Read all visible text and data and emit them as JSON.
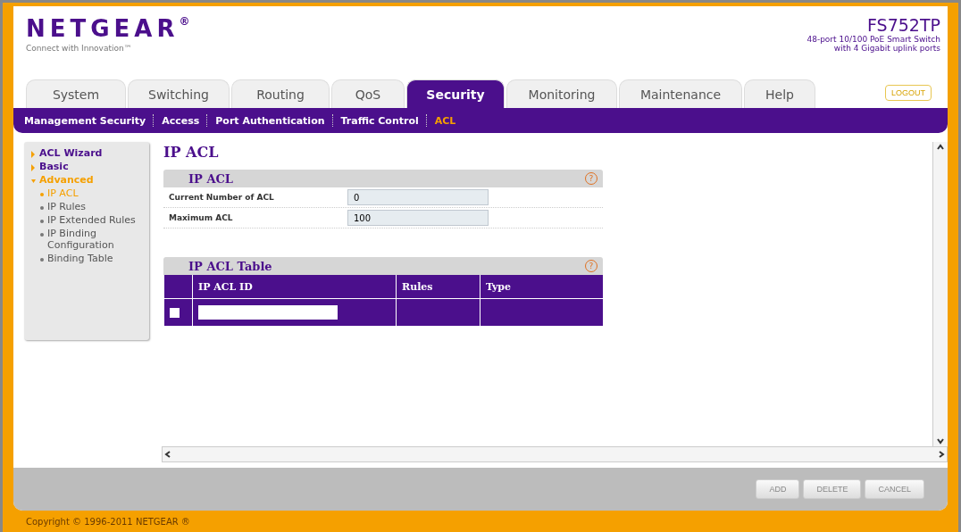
{
  "brand": {
    "logo": "NETGEAR",
    "registered": "®",
    "tagline": "Connect with Innovation™"
  },
  "product": {
    "model": "FS752TP",
    "description_1": "48-port 10/100 PoE Smart Switch",
    "description_2": "with 4 Gigabit uplink ports"
  },
  "logout": "LOGOUT",
  "tabs": [
    {
      "label": "System",
      "selected": false
    },
    {
      "label": "Switching",
      "selected": false
    },
    {
      "label": "Routing",
      "selected": false
    },
    {
      "label": "QoS",
      "selected": false
    },
    {
      "label": "Security",
      "selected": true
    },
    {
      "label": "Monitoring",
      "selected": false
    },
    {
      "label": "Maintenance",
      "selected": false
    },
    {
      "label": "Help",
      "selected": false
    }
  ],
  "subtabs": [
    {
      "label": "Management Security",
      "selected": false
    },
    {
      "label": "Access",
      "selected": false
    },
    {
      "label": "Port Authentication",
      "selected": false
    },
    {
      "label": "Traffic Control",
      "selected": false
    },
    {
      "label": "ACL",
      "selected": true
    }
  ],
  "sidebar": {
    "items": [
      {
        "label": "ACL Wizard",
        "selected": false,
        "expanded": false
      },
      {
        "label": "Basic",
        "selected": false,
        "expanded": false
      },
      {
        "label": "Advanced",
        "selected": true,
        "expanded": true,
        "children": [
          {
            "label": "IP ACL",
            "selected": true
          },
          {
            "label": "IP Rules",
            "selected": false
          },
          {
            "label": "IP Extended Rules",
            "selected": false
          },
          {
            "label": "IP Binding Configuration",
            "selected": false
          },
          {
            "label": "Binding Table",
            "selected": false
          }
        ]
      }
    ]
  },
  "page_title": "IP ACL",
  "acl_panel": {
    "title": "IP ACL",
    "help": "?",
    "fields": [
      {
        "label": "Current Number of ACL",
        "value": "0"
      },
      {
        "label": "Maximum ACL",
        "value": "100"
      }
    ]
  },
  "acl_table": {
    "title": "IP ACL Table",
    "help": "?",
    "columns": [
      "IP ACL ID",
      "Rules",
      "Type"
    ],
    "rows": [
      {
        "checked": false,
        "kind": "input"
      }
    ]
  },
  "buttons": [
    "ADD",
    "DELETE",
    "CANCEL"
  ],
  "footer": "Copyright © 1996-2011 NETGEAR ®"
}
